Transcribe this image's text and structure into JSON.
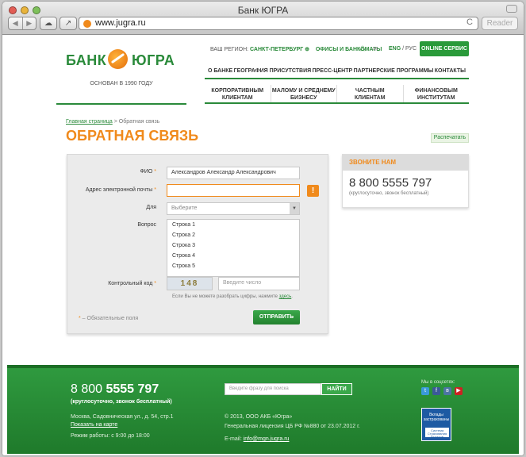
{
  "browser": {
    "title": "Банк ЮГРА",
    "url": "www.jugra.ru",
    "reader_label": "Reader",
    "back_glyph": "◀",
    "forward_glyph": "▶",
    "reload_glyph": "C",
    "cloud_glyph": "☁",
    "share_glyph": "↗",
    "plus_glyph": "+"
  },
  "header": {
    "logo_left": "БАНК",
    "logo_right": "ЮГРА",
    "founded": "ОСНОВАН В 1990 ГОДУ",
    "region_label": "ВАШ РЕГИОН:",
    "region_value": "САНКТ-ПЕТЕРБУРГ ⊕",
    "offices": "ОФИСЫ И БАНКОМАТЫ",
    "sitemap_glyph": "⁂",
    "mail_glyph": "✉",
    "lang_en": "ENG",
    "lang_sep": " / ",
    "lang_ru": "РУС",
    "online_label": "ONLINE СЕРВИС"
  },
  "menu_top": [
    "О БАНКЕ",
    "ГЕОГРАФИЯ ПРИСУТСТВИЯ",
    "ПРЕСС-ЦЕНТР",
    "ПАРТНЕРСКИЕ ПРОГРАММЫ",
    "КОНТАКТЫ"
  ],
  "menu_clients": [
    [
      "КОРПОРАТИВНЫМ",
      "КЛИЕНТАМ"
    ],
    [
      "МАЛОМУ И СРЕДНЕМУ",
      "БИЗНЕСУ"
    ],
    [
      "ЧАСТНЫМ",
      "КЛИЕНТАМ"
    ],
    [
      "ФИНАНСОВЫМ",
      "ИНСТИТУТАМ"
    ]
  ],
  "breadcrumb": {
    "home": "Главная страница",
    "sep": " > ",
    "current": "Обратная связь"
  },
  "page_title": "ОБРАТНАЯ СВЯЗЬ",
  "print_label": "Распечатать",
  "form": {
    "req_mark": "*",
    "fio_label": "ФИО",
    "fio_value": "Александров Александр Александрович",
    "email_label": "Адрес электронной почты",
    "email_value": "",
    "error_glyph": "!",
    "for_label": "Для",
    "for_value": "Выберите",
    "select_glyph": "▼",
    "question_label": "Вопрос",
    "question_lines": [
      "Строка 1",
      "Строка 2",
      "Строка 3",
      "Строка 4",
      "Строка 5"
    ],
    "captcha_label": "Контрольный код",
    "captcha_text": "148",
    "captcha_placeholder": "Введите число",
    "captcha_hint": "Если Вы не можете разобрать цифры, нажмите ",
    "captcha_hint_link": "здесь",
    "captcha_hint_end": ".",
    "required_note": " – Обязательные поля",
    "submit_label": "ОТПРАВИТЬ"
  },
  "callbox": {
    "title": "ЗВОНИТЕ НАМ",
    "phone": "8 800 5555 797",
    "note": "(круглосуточно, звонок бесплатный)"
  },
  "footer": {
    "phone_prefix": "8 800 ",
    "phone_bold": "5555 797",
    "phone_note": "(круглосуточно, звонок бесплатный)",
    "address": "Москва, Садовническая ул., д. 54, стр.1",
    "map_link": "Показать на карте",
    "hours": "Режим работы: с 9:00 до 18:00",
    "search_placeholder": "Введите фразу для поиска",
    "search_button": "НАЙТИ",
    "copyright": "© 2013, ООО АКБ «Югра»",
    "license": "Генеральная лицензия ЦБ РФ №880 от 23.07.2012 г.",
    "email_label": "E-mail: ",
    "email": "info@mgn.jugra.ru",
    "social_label": "Мы в соцсетях:",
    "social": [
      {
        "glyph": "t",
        "color": "#3a9ad9"
      },
      {
        "glyph": "f",
        "color": "#3b5998"
      },
      {
        "glyph": "в",
        "color": "#4c75a3"
      },
      {
        "glyph": "▶",
        "color": "#cc2222"
      }
    ],
    "deposit_line1": "Вклады",
    "deposit_line2": "застрахованы",
    "deposit_badge": "Система Страхования Вкладов"
  }
}
